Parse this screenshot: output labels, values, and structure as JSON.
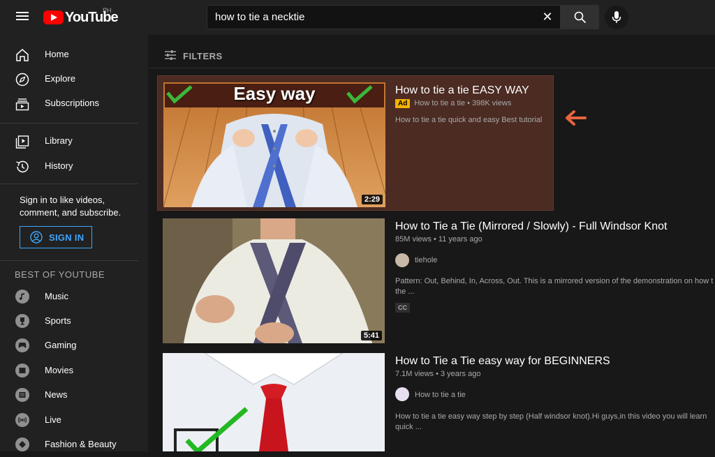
{
  "header": {
    "logo_text": "YouTube",
    "country": "PH",
    "search_value": "how to tie a necktie",
    "clear_symbol": "✕"
  },
  "sidebar": {
    "main_items": [
      {
        "label": "Home",
        "icon": "home-icon"
      },
      {
        "label": "Explore",
        "icon": "compass-icon"
      },
      {
        "label": "Subscriptions",
        "icon": "subscriptions-icon"
      }
    ],
    "library_items": [
      {
        "label": "Library",
        "icon": "library-icon"
      },
      {
        "label": "History",
        "icon": "history-icon"
      }
    ],
    "signin_prompt": "Sign in to like videos, comment, and subscribe.",
    "signin_label": "SIGN IN",
    "section_title": "BEST OF YOUTUBE",
    "best_items": [
      {
        "label": "Music",
        "icon": "music-icon"
      },
      {
        "label": "Sports",
        "icon": "trophy-icon"
      },
      {
        "label": "Gaming",
        "icon": "gaming-icon"
      },
      {
        "label": "Movies",
        "icon": "movies-icon"
      },
      {
        "label": "News",
        "icon": "news-icon"
      },
      {
        "label": "Live",
        "icon": "live-icon"
      },
      {
        "label": "Fashion & Beauty",
        "icon": "fashion-icon"
      }
    ]
  },
  "main": {
    "filters_label": "FILTERS",
    "ad": {
      "title": "How to tie a tie EASY WAY",
      "badge": "Ad",
      "channel_views": "How to tie a tie • 398K views",
      "description": "How to tie a tie quick and easy Best tutorial",
      "thumb_banner": "Easy way",
      "duration": "2:29"
    },
    "videos": [
      {
        "title": "How to Tie a Tie (Mirrored / Slowly) - Full Windsor Knot",
        "meta": "85M views • 11 years ago",
        "channel": "tiehole",
        "description_line1": "Pattern: Out, Behind, In, Across, Out. This is a mirrored version of the demonstration on how t",
        "description_line2": "the ...",
        "badge": "CC",
        "duration": "5:41"
      },
      {
        "title": "How to Tie a Tie easy way for BEGINNERS",
        "meta": "7.1M views • 3 years ago",
        "channel": "How to tie a tie",
        "description_line1": "How to tie a tie easy way step by step (Half windsor knot).Hi guys,in this video you will learn",
        "description_line2": "quick ..."
      }
    ]
  },
  "colors": {
    "accent_blue": "#3ea6ff",
    "ad_background": "#4b2b22",
    "ad_badge": "#f2b300",
    "arrow": "#e8643e",
    "brand_red": "#ff0000"
  }
}
